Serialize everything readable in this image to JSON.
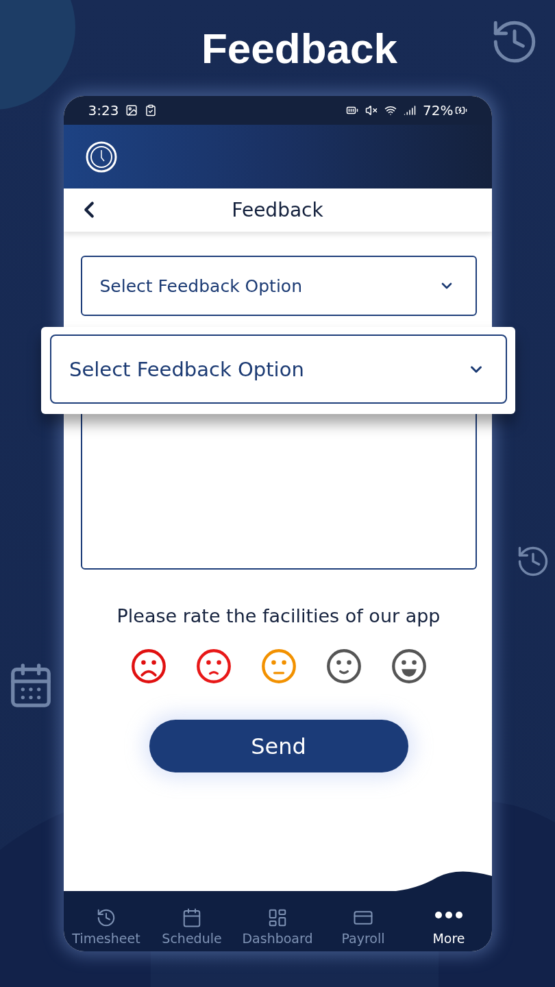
{
  "page_title": "Feedback",
  "status_bar": {
    "time": "3:23",
    "battery": "72%"
  },
  "screen": {
    "title": "Feedback"
  },
  "feedback_option": {
    "placeholder": "Select Feedback Option"
  },
  "callout": {
    "placeholder": "Select Feedback Option"
  },
  "rating": {
    "prompt": "Please rate the facilities of our app",
    "faces": [
      {
        "kind": "very_sad",
        "color": "#e01010"
      },
      {
        "kind": "sad",
        "color": "#e81818"
      },
      {
        "kind": "neutral",
        "color": "#f29100"
      },
      {
        "kind": "happy",
        "color": "#555555"
      },
      {
        "kind": "very_happy",
        "color": "#555555"
      }
    ]
  },
  "send_button": "Send",
  "bottom_nav": [
    {
      "label": "Timesheet",
      "kind": "timesheet",
      "selected": false
    },
    {
      "label": "Schedule",
      "kind": "schedule",
      "selected": false
    },
    {
      "label": "Dashboard",
      "kind": "dashboard",
      "selected": false
    },
    {
      "label": "Payroll",
      "kind": "payroll",
      "selected": false
    },
    {
      "label": "More",
      "kind": "more",
      "selected": true
    }
  ]
}
